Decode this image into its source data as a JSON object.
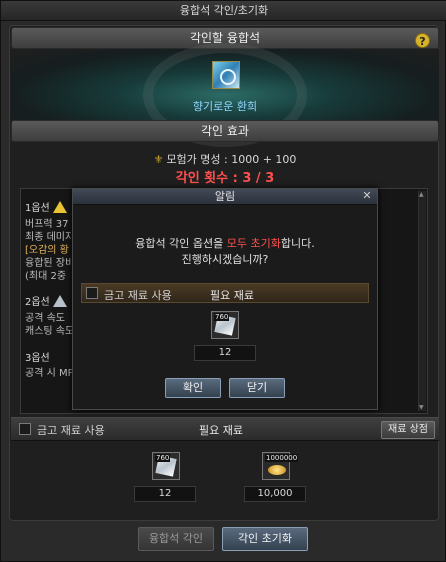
{
  "window": {
    "title": "융합석 각인/초기화"
  },
  "top_section": {
    "header": "각인할 융합석",
    "help_icon": "question-icon",
    "stone_name": "향기로운 환희"
  },
  "effect_section": {
    "header": "각인 효과",
    "fame_label": "모험가 명성 : 1000 + 100",
    "count_label": "각인 횟수 : 3 / 3"
  },
  "options": {
    "opt1_title": "1옵션",
    "opt1_lines": [
      "버프력 37",
      "최종 데미지",
      "[오감의 황",
      "융합된 장비",
      "(최대 2중"
    ],
    "opt2_title": "2옵션",
    "opt2_lines": [
      "공격 속도",
      "캐스팅 속도"
    ],
    "opt3_title": "3옵션",
    "opt3_lines": [
      "공격 시 MP"
    ]
  },
  "materials": {
    "use_vault_label": "금고 재료 사용",
    "required_label": "필요 재료",
    "shop_button": "재료 상점",
    "items": [
      {
        "icon": "crystal-icon",
        "badge": "760",
        "qty": "12"
      },
      {
        "icon": "gold-coins-icon",
        "badge": "1000000",
        "qty": "10,000"
      }
    ]
  },
  "buttons": {
    "engrave": "융합석 각인",
    "reset": "각인 초기화"
  },
  "dialog": {
    "title": "알림",
    "msg1_a": "융합석 각인 옵션을 ",
    "msg1_b": "모두 초기화",
    "msg1_c": "합니다.",
    "msg2": "진행하시겠습니까?",
    "use_vault_label": "금고 재료 사용",
    "required_label": "필요 재료",
    "item_badge": "760",
    "item_qty": "12",
    "confirm": "확인",
    "close": "닫기"
  }
}
